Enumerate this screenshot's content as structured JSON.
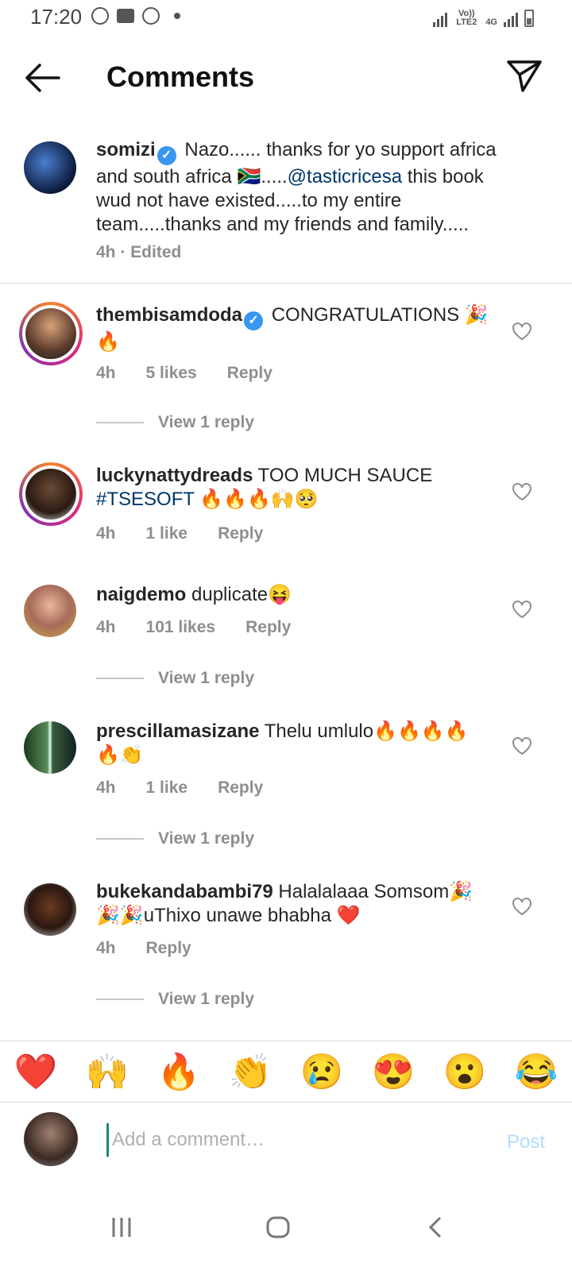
{
  "status_bar": {
    "time": "17:20",
    "net_label": "Vo)) LTE2",
    "net_label2": "4G"
  },
  "header": {
    "title": "Comments"
  },
  "caption": {
    "username": "somizi",
    "text_before": "Nazo...... thanks for yo support africa and south africa 🇿🇦.....",
    "mention": "@tasticricesa",
    "text_after": " this book wud not have existed.....to my entire team.....thanks and my friends and family.....",
    "meta": "4h · Edited"
  },
  "comments": [
    {
      "username": "thembisamdoda",
      "text": "CONGRATULATIONS 🎉 🔥",
      "time": "4h",
      "likes": "5 likes",
      "reply": "Reply",
      "view_reply": "View 1 reply"
    },
    {
      "username": "luckynattydreads",
      "text": "TOO MUCH SAUCE",
      "hashtag": "#TSESOFT",
      "emojis": " 🔥🔥🔥🙌🥺",
      "time": "4h",
      "likes": "1 like",
      "reply": "Reply"
    },
    {
      "username": "naigdemo",
      "text": "duplicate😝",
      "time": "4h",
      "likes": "101 likes",
      "reply": "Reply",
      "view_reply": "View 1 reply"
    },
    {
      "username": "prescillamasizane",
      "text": "Thelu umlulo🔥🔥🔥🔥 🔥👏",
      "time": "4h",
      "likes": "1 like",
      "reply": "Reply",
      "view_reply": "View 1 reply"
    },
    {
      "username": "bukekandabambi79",
      "text": "Halalalaaa Somsom🎉 🎉🎉uThixo unawe bhabha ❤️",
      "time": "4h",
      "reply": "Reply",
      "view_reply": "View 1 reply"
    }
  ],
  "emoji_bar": [
    "❤️",
    "🙌",
    "🔥",
    "👏",
    "😢",
    "😍",
    "😮",
    "😂"
  ],
  "composer": {
    "placeholder": "Add a comment…",
    "post_label": "Post"
  },
  "colors": {
    "link": "#00376b",
    "verified": "#3897f0",
    "meta": "#8e8e8e",
    "post_disabled": "#b3dbff"
  }
}
